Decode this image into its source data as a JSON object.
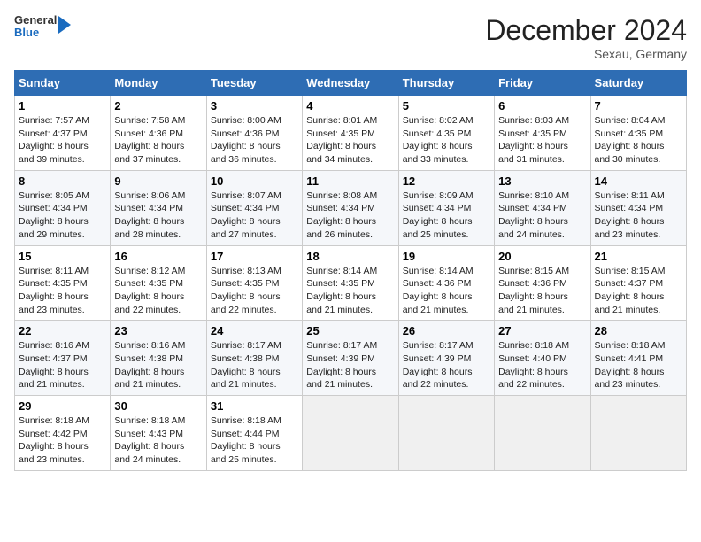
{
  "header": {
    "logo_general": "General",
    "logo_blue": "Blue",
    "title": "December 2024",
    "subtitle": "Sexau, Germany"
  },
  "days_of_week": [
    "Sunday",
    "Monday",
    "Tuesday",
    "Wednesday",
    "Thursday",
    "Friday",
    "Saturday"
  ],
  "weeks": [
    [
      {
        "day": 1,
        "lines": [
          "Sunrise: 7:57 AM",
          "Sunset: 4:37 PM",
          "Daylight: 8 hours",
          "and 39 minutes."
        ]
      },
      {
        "day": 2,
        "lines": [
          "Sunrise: 7:58 AM",
          "Sunset: 4:36 PM",
          "Daylight: 8 hours",
          "and 37 minutes."
        ]
      },
      {
        "day": 3,
        "lines": [
          "Sunrise: 8:00 AM",
          "Sunset: 4:36 PM",
          "Daylight: 8 hours",
          "and 36 minutes."
        ]
      },
      {
        "day": 4,
        "lines": [
          "Sunrise: 8:01 AM",
          "Sunset: 4:35 PM",
          "Daylight: 8 hours",
          "and 34 minutes."
        ]
      },
      {
        "day": 5,
        "lines": [
          "Sunrise: 8:02 AM",
          "Sunset: 4:35 PM",
          "Daylight: 8 hours",
          "and 33 minutes."
        ]
      },
      {
        "day": 6,
        "lines": [
          "Sunrise: 8:03 AM",
          "Sunset: 4:35 PM",
          "Daylight: 8 hours",
          "and 31 minutes."
        ]
      },
      {
        "day": 7,
        "lines": [
          "Sunrise: 8:04 AM",
          "Sunset: 4:35 PM",
          "Daylight: 8 hours",
          "and 30 minutes."
        ]
      }
    ],
    [
      {
        "day": 8,
        "lines": [
          "Sunrise: 8:05 AM",
          "Sunset: 4:34 PM",
          "Daylight: 8 hours",
          "and 29 minutes."
        ]
      },
      {
        "day": 9,
        "lines": [
          "Sunrise: 8:06 AM",
          "Sunset: 4:34 PM",
          "Daylight: 8 hours",
          "and 28 minutes."
        ]
      },
      {
        "day": 10,
        "lines": [
          "Sunrise: 8:07 AM",
          "Sunset: 4:34 PM",
          "Daylight: 8 hours",
          "and 27 minutes."
        ]
      },
      {
        "day": 11,
        "lines": [
          "Sunrise: 8:08 AM",
          "Sunset: 4:34 PM",
          "Daylight: 8 hours",
          "and 26 minutes."
        ]
      },
      {
        "day": 12,
        "lines": [
          "Sunrise: 8:09 AM",
          "Sunset: 4:34 PM",
          "Daylight: 8 hours",
          "and 25 minutes."
        ]
      },
      {
        "day": 13,
        "lines": [
          "Sunrise: 8:10 AM",
          "Sunset: 4:34 PM",
          "Daylight: 8 hours",
          "and 24 minutes."
        ]
      },
      {
        "day": 14,
        "lines": [
          "Sunrise: 8:11 AM",
          "Sunset: 4:34 PM",
          "Daylight: 8 hours",
          "and 23 minutes."
        ]
      }
    ],
    [
      {
        "day": 15,
        "lines": [
          "Sunrise: 8:11 AM",
          "Sunset: 4:35 PM",
          "Daylight: 8 hours",
          "and 23 minutes."
        ]
      },
      {
        "day": 16,
        "lines": [
          "Sunrise: 8:12 AM",
          "Sunset: 4:35 PM",
          "Daylight: 8 hours",
          "and 22 minutes."
        ]
      },
      {
        "day": 17,
        "lines": [
          "Sunrise: 8:13 AM",
          "Sunset: 4:35 PM",
          "Daylight: 8 hours",
          "and 22 minutes."
        ]
      },
      {
        "day": 18,
        "lines": [
          "Sunrise: 8:14 AM",
          "Sunset: 4:35 PM",
          "Daylight: 8 hours",
          "and 21 minutes."
        ]
      },
      {
        "day": 19,
        "lines": [
          "Sunrise: 8:14 AM",
          "Sunset: 4:36 PM",
          "Daylight: 8 hours",
          "and 21 minutes."
        ]
      },
      {
        "day": 20,
        "lines": [
          "Sunrise: 8:15 AM",
          "Sunset: 4:36 PM",
          "Daylight: 8 hours",
          "and 21 minutes."
        ]
      },
      {
        "day": 21,
        "lines": [
          "Sunrise: 8:15 AM",
          "Sunset: 4:37 PM",
          "Daylight: 8 hours",
          "and 21 minutes."
        ]
      }
    ],
    [
      {
        "day": 22,
        "lines": [
          "Sunrise: 8:16 AM",
          "Sunset: 4:37 PM",
          "Daylight: 8 hours",
          "and 21 minutes."
        ]
      },
      {
        "day": 23,
        "lines": [
          "Sunrise: 8:16 AM",
          "Sunset: 4:38 PM",
          "Daylight: 8 hours",
          "and 21 minutes."
        ]
      },
      {
        "day": 24,
        "lines": [
          "Sunrise: 8:17 AM",
          "Sunset: 4:38 PM",
          "Daylight: 8 hours",
          "and 21 minutes."
        ]
      },
      {
        "day": 25,
        "lines": [
          "Sunrise: 8:17 AM",
          "Sunset: 4:39 PM",
          "Daylight: 8 hours",
          "and 21 minutes."
        ]
      },
      {
        "day": 26,
        "lines": [
          "Sunrise: 8:17 AM",
          "Sunset: 4:39 PM",
          "Daylight: 8 hours",
          "and 22 minutes."
        ]
      },
      {
        "day": 27,
        "lines": [
          "Sunrise: 8:18 AM",
          "Sunset: 4:40 PM",
          "Daylight: 8 hours",
          "and 22 minutes."
        ]
      },
      {
        "day": 28,
        "lines": [
          "Sunrise: 8:18 AM",
          "Sunset: 4:41 PM",
          "Daylight: 8 hours",
          "and 23 minutes."
        ]
      }
    ],
    [
      {
        "day": 29,
        "lines": [
          "Sunrise: 8:18 AM",
          "Sunset: 4:42 PM",
          "Daylight: 8 hours",
          "and 23 minutes."
        ]
      },
      {
        "day": 30,
        "lines": [
          "Sunrise: 8:18 AM",
          "Sunset: 4:43 PM",
          "Daylight: 8 hours",
          "and 24 minutes."
        ]
      },
      {
        "day": 31,
        "lines": [
          "Sunrise: 8:18 AM",
          "Sunset: 4:44 PM",
          "Daylight: 8 hours",
          "and 25 minutes."
        ]
      },
      null,
      null,
      null,
      null
    ]
  ]
}
